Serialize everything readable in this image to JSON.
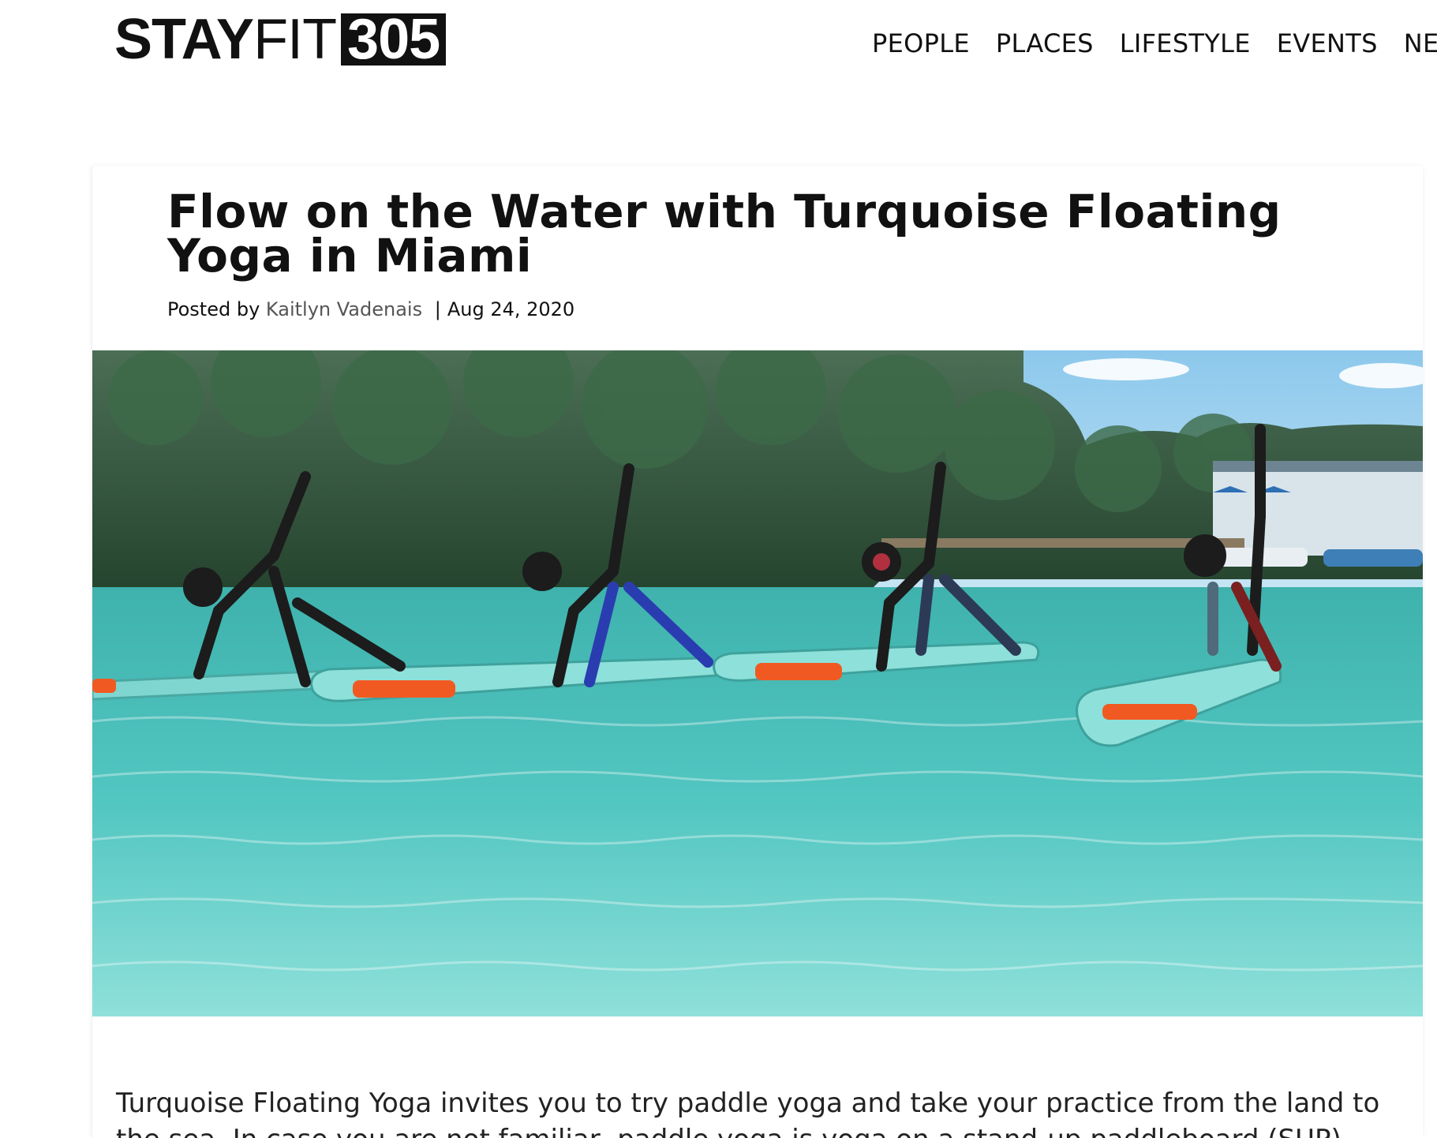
{
  "header": {
    "logo": {
      "part_bold": "STAY",
      "part_light": "FIT",
      "part_box": "305"
    },
    "nav": [
      "PEOPLE",
      "PLACES",
      "LIFESTYLE",
      "EVENTS",
      "NEWS"
    ]
  },
  "article": {
    "title": "Flow on the Water with Turquoise Floating Yoga in Miami",
    "meta": {
      "posted_by_label": "Posted by",
      "author": "Kaitlyn Vadenais",
      "separator": "|",
      "date": "Aug 24, 2020"
    },
    "body": "Turquoise Floating Yoga invites you to try paddle yoga and take your practice from the land to the sea. In case you are not familiar, paddle yoga is yoga on a stand-up paddleboard (SUP)."
  },
  "colors": {
    "water": "#4fc4c0",
    "sky": "#9fd0ec",
    "trees": "#2f5a3a",
    "board": "#7fd6d0",
    "float": "#f05a22"
  }
}
